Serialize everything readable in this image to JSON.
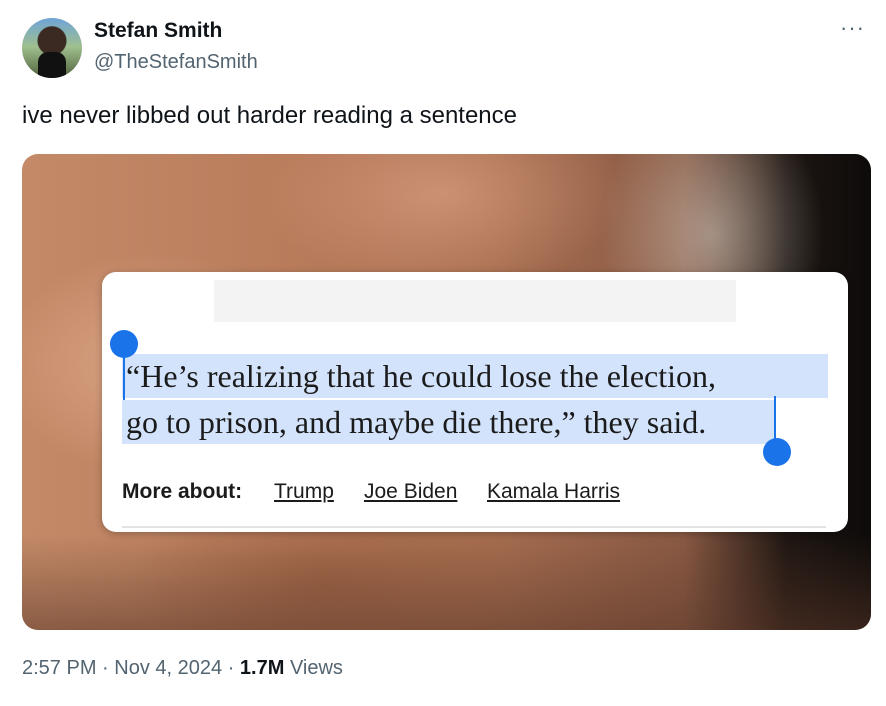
{
  "author": {
    "display_name": "Stefan Smith",
    "handle": "@TheStefanSmith"
  },
  "menu": {
    "more_icon": "more-horizontal-icon",
    "more_glyph": "···"
  },
  "tweet": {
    "text": "ive never libbed out harder reading a sentence"
  },
  "media": {
    "quote_line_1": "“He’s realizing that he could lose the election,",
    "quote_line_2": "go to prison, and maybe die there,” they said.",
    "more_about_label": "More about:",
    "topics": [
      "Trump",
      "Joe Biden",
      "Kamala Harris"
    ],
    "selection_color": "#d3e3fb",
    "handle_color": "#1a73e8"
  },
  "meta": {
    "time": "2:57 PM",
    "date": "Nov 4, 2024",
    "views_count": "1.7M",
    "views_label": "Views"
  }
}
